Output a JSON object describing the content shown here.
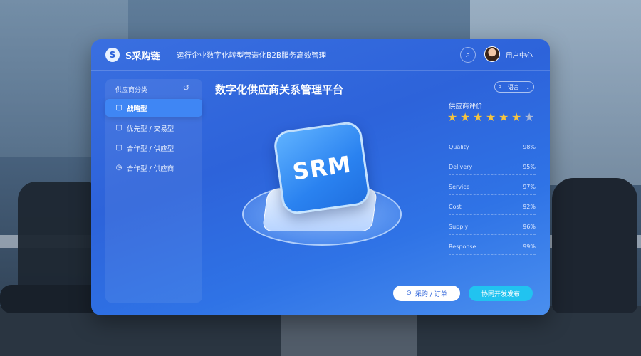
{
  "header": {
    "logo_icon": "S",
    "logo_text": "S采购链",
    "tagline": "运行企业数字化转型营造化B2B服务高效管理",
    "search_icon": "search-icon",
    "user_name": "用户中心"
  },
  "sidebar": {
    "heading": "供应商分类",
    "collapse_glyph": "↺",
    "items": [
      {
        "label": "战略型",
        "icon": "▢"
      },
      {
        "label": "优先型 / 交易型",
        "icon": "▢"
      },
      {
        "label": "合作型 / 供应型",
        "icon": "▢"
      },
      {
        "label": "合作型 / 供应商",
        "icon": "◷"
      }
    ]
  },
  "main": {
    "title": "数字化供应商关系管理平台",
    "lang_label": "语言",
    "graphic_text": "SRM"
  },
  "rating": {
    "title": "供应商评价",
    "stars_total": 7,
    "stars_filled": 6,
    "metrics": [
      {
        "label": "Quality",
        "value": "98%"
      },
      {
        "label": "Delivery",
        "value": "95%"
      },
      {
        "label": "Service",
        "value": "97%"
      },
      {
        "label": "Cost",
        "value": "92%"
      },
      {
        "label": "Supply",
        "value": "96%"
      },
      {
        "label": "Response",
        "value": "99%"
      }
    ]
  },
  "buttons": {
    "purchase": "采购 / 订单",
    "collaborate": "协同开发发布"
  },
  "colors": {
    "accent": "#2d63da",
    "accent_button": "#21c3f0",
    "star": "#f5c440"
  }
}
